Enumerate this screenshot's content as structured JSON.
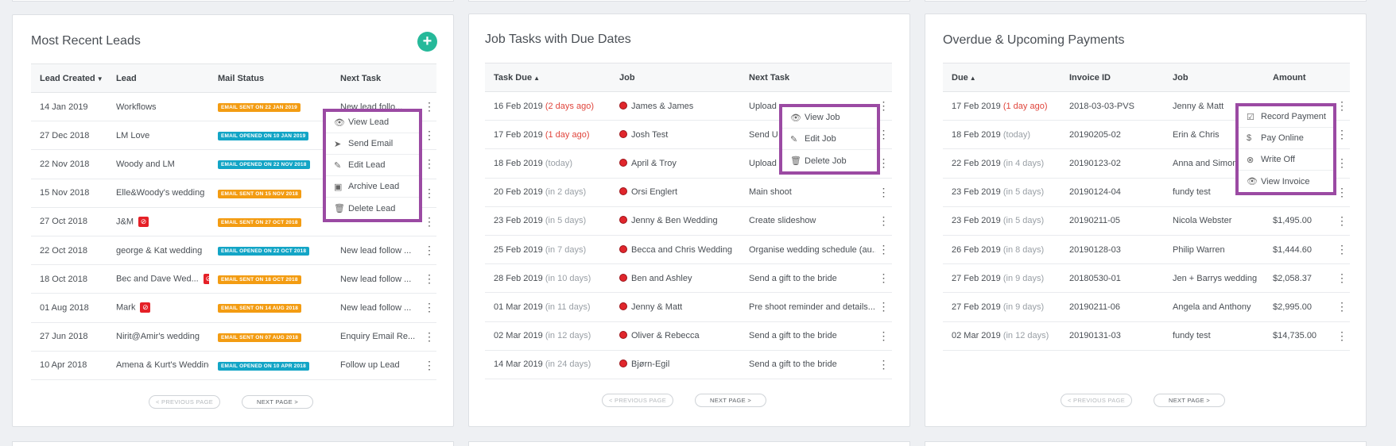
{
  "leads": {
    "title": "Most Recent Leads",
    "add_icon": "plus-icon",
    "headers": [
      "Lead Created",
      "Lead",
      "Mail Status",
      "Next Task"
    ],
    "rows": [
      {
        "date": "14 Jan 2019",
        "lead": "Workflows",
        "flag": false,
        "status": "EMAIL SENT ON 22 JAN 2019",
        "status_type": "sent",
        "task": "New lead follo..."
      },
      {
        "date": "27 Dec 2018",
        "lead": "LM Love",
        "flag": false,
        "status": "EMAIL OPENED ON 10 JAN 2019",
        "status_type": "opened",
        "task": ""
      },
      {
        "date": "22 Nov 2018",
        "lead": "Woody and LM",
        "flag": false,
        "status": "EMAIL OPENED ON 22 NOV 2018",
        "status_type": "opened",
        "task": ""
      },
      {
        "date": "15 Nov 2018",
        "lead": "Elle&Woody's wedding",
        "flag": false,
        "status": "EMAIL SENT ON 15 NOV 2018",
        "status_type": "sent",
        "task": ""
      },
      {
        "date": "27 Oct 2018",
        "lead": "J&M",
        "flag": true,
        "status": "EMAIL SENT ON 27 OCT 2018",
        "status_type": "sent",
        "task": ""
      },
      {
        "date": "22 Oct 2018",
        "lead": "george & Kat wedding",
        "flag": false,
        "status": "EMAIL OPENED ON 22 OCT 2018",
        "status_type": "opened",
        "task": "New lead follow ..."
      },
      {
        "date": "18 Oct 2018",
        "lead": "Bec and Dave Wed...",
        "flag": true,
        "status": "EMAIL SENT ON 18 OCT 2018",
        "status_type": "sent",
        "task": "New lead follow ..."
      },
      {
        "date": "01 Aug 2018",
        "lead": "Mark",
        "flag": true,
        "status": "EMAIL SENT ON 14 AUG 2018",
        "status_type": "sent",
        "task": "New lead follow ..."
      },
      {
        "date": "27 Jun 2018",
        "lead": "Nirit@Amir's wedding",
        "flag": false,
        "status": "EMAIL SENT ON 07 AUG 2018",
        "status_type": "sent",
        "task": "Enquiry Email Re..."
      },
      {
        "date": "10 Apr 2018",
        "lead": "Amena & Kurt's Wedding",
        "flag": false,
        "status": "EMAIL OPENED ON 10 APR 2018",
        "status_type": "opened",
        "task": "Follow up Lead"
      }
    ],
    "menu": [
      {
        "icon": "eye-icon",
        "label": "View Lead"
      },
      {
        "icon": "send-icon",
        "label": "Send Email"
      },
      {
        "icon": "pencil-icon",
        "label": "Edit Lead"
      },
      {
        "icon": "archive-icon",
        "label": "Archive Lead"
      },
      {
        "icon": "trash-icon",
        "label": "Delete Lead"
      }
    ],
    "prev": "<  PREVIOUS PAGE",
    "next": "NEXT PAGE  >"
  },
  "jobs": {
    "title": "Job Tasks with Due Dates",
    "headers": [
      "Task Due",
      "Job",
      "Next Task"
    ],
    "rows": [
      {
        "date": "16 Feb 2019",
        "rel": "(2 days ago)",
        "overdue": true,
        "job": "James & James",
        "task": "Upload"
      },
      {
        "date": "17 Feb 2019",
        "rel": "(1 day ago)",
        "overdue": true,
        "job": "Josh Test",
        "task": "Send U"
      },
      {
        "date": "18 Feb 2019",
        "rel": "(today)",
        "overdue": false,
        "job": "April & Troy",
        "task": "Upload"
      },
      {
        "date": "20 Feb 2019",
        "rel": "(in 2 days)",
        "overdue": false,
        "job": "Orsi Englert",
        "task": "Main shoot"
      },
      {
        "date": "23 Feb 2019",
        "rel": "(in 5 days)",
        "overdue": false,
        "job": "Jenny & Ben Wedding",
        "task": "Create slideshow"
      },
      {
        "date": "25 Feb 2019",
        "rel": "(in 7 days)",
        "overdue": false,
        "job": "Becca and Chris Wedding",
        "task": "Organise wedding schedule (au..."
      },
      {
        "date": "28 Feb 2019",
        "rel": "(in 10 days)",
        "overdue": false,
        "job": "Ben and Ashley",
        "task": "Send a gift to the bride"
      },
      {
        "date": "01 Mar 2019",
        "rel": "(in 11 days)",
        "overdue": false,
        "job": "Jenny & Matt",
        "task": "Pre shoot reminder and details..."
      },
      {
        "date": "02 Mar 2019",
        "rel": "(in 12 days)",
        "overdue": false,
        "job": "Oliver & Rebecca",
        "task": "Send a gift to the bride"
      },
      {
        "date": "14 Mar 2019",
        "rel": "(in 24 days)",
        "overdue": false,
        "job": "Bjørn-Egil",
        "task": "Send a gift to the bride"
      }
    ],
    "menu": [
      {
        "icon": "eye-icon",
        "label": "View Job"
      },
      {
        "icon": "pencil-icon",
        "label": "Edit Job"
      },
      {
        "icon": "trash-icon",
        "label": "Delete Job"
      }
    ],
    "prev": "<  PREVIOUS PAGE",
    "next": "NEXT PAGE  >"
  },
  "payments": {
    "title": "Overdue & Upcoming Payments",
    "headers": [
      "Due",
      "Invoice ID",
      "Job",
      "Amount"
    ],
    "rows": [
      {
        "date": "17 Feb 2019",
        "rel": "(1 day ago)",
        "overdue": true,
        "invoice": "2018-03-03-PVS",
        "job": "Jenny & Matt",
        "amount": ""
      },
      {
        "date": "18 Feb 2019",
        "rel": "(today)",
        "overdue": false,
        "invoice": "20190205-02",
        "job": "Erin & Chris",
        "amount": ""
      },
      {
        "date": "22 Feb 2019",
        "rel": "(in 4 days)",
        "overdue": false,
        "invoice": "20190123-02",
        "job": "Anna and Simon W",
        "amount": ""
      },
      {
        "date": "23 Feb 2019",
        "rel": "(in 5 days)",
        "overdue": false,
        "invoice": "20190124-04",
        "job": "fundy test",
        "amount": ""
      },
      {
        "date": "23 Feb 2019",
        "rel": "(in 5 days)",
        "overdue": false,
        "invoice": "20190211-05",
        "job": "Nicola Webster",
        "amount": "$1,495.00"
      },
      {
        "date": "26 Feb 2019",
        "rel": "(in 8 days)",
        "overdue": false,
        "invoice": "20190128-03",
        "job": "Philip Warren",
        "amount": "$1,444.60"
      },
      {
        "date": "27 Feb 2019",
        "rel": "(in 9 days)",
        "overdue": false,
        "invoice": "20180530-01",
        "job": "Jen + Barrys wedding",
        "amount": "$2,058.37"
      },
      {
        "date": "27 Feb 2019",
        "rel": "(in 9 days)",
        "overdue": false,
        "invoice": "20190211-06",
        "job": "Angela and Anthony",
        "amount": "$2,995.00"
      },
      {
        "date": "02 Mar 2019",
        "rel": "(in 12 days)",
        "overdue": false,
        "invoice": "20190131-03",
        "job": "fundy test",
        "amount": "$14,735.00"
      }
    ],
    "menu": [
      {
        "icon": "receipt-icon",
        "label": "Record Payment"
      },
      {
        "icon": "dollar-icon",
        "label": "Pay Online"
      },
      {
        "icon": "cancel-circle-icon",
        "label": "Write Off"
      },
      {
        "icon": "eye-icon",
        "label": "View Invoice"
      }
    ],
    "prev": "<  PREVIOUS PAGE",
    "next": "NEXT PAGE  >"
  },
  "colors": {
    "accent": "#26b99a",
    "menu_border": "#9b4aa3",
    "sent": "#f39c12",
    "opened": "#13a5c6",
    "overdue": "#e0453c"
  }
}
